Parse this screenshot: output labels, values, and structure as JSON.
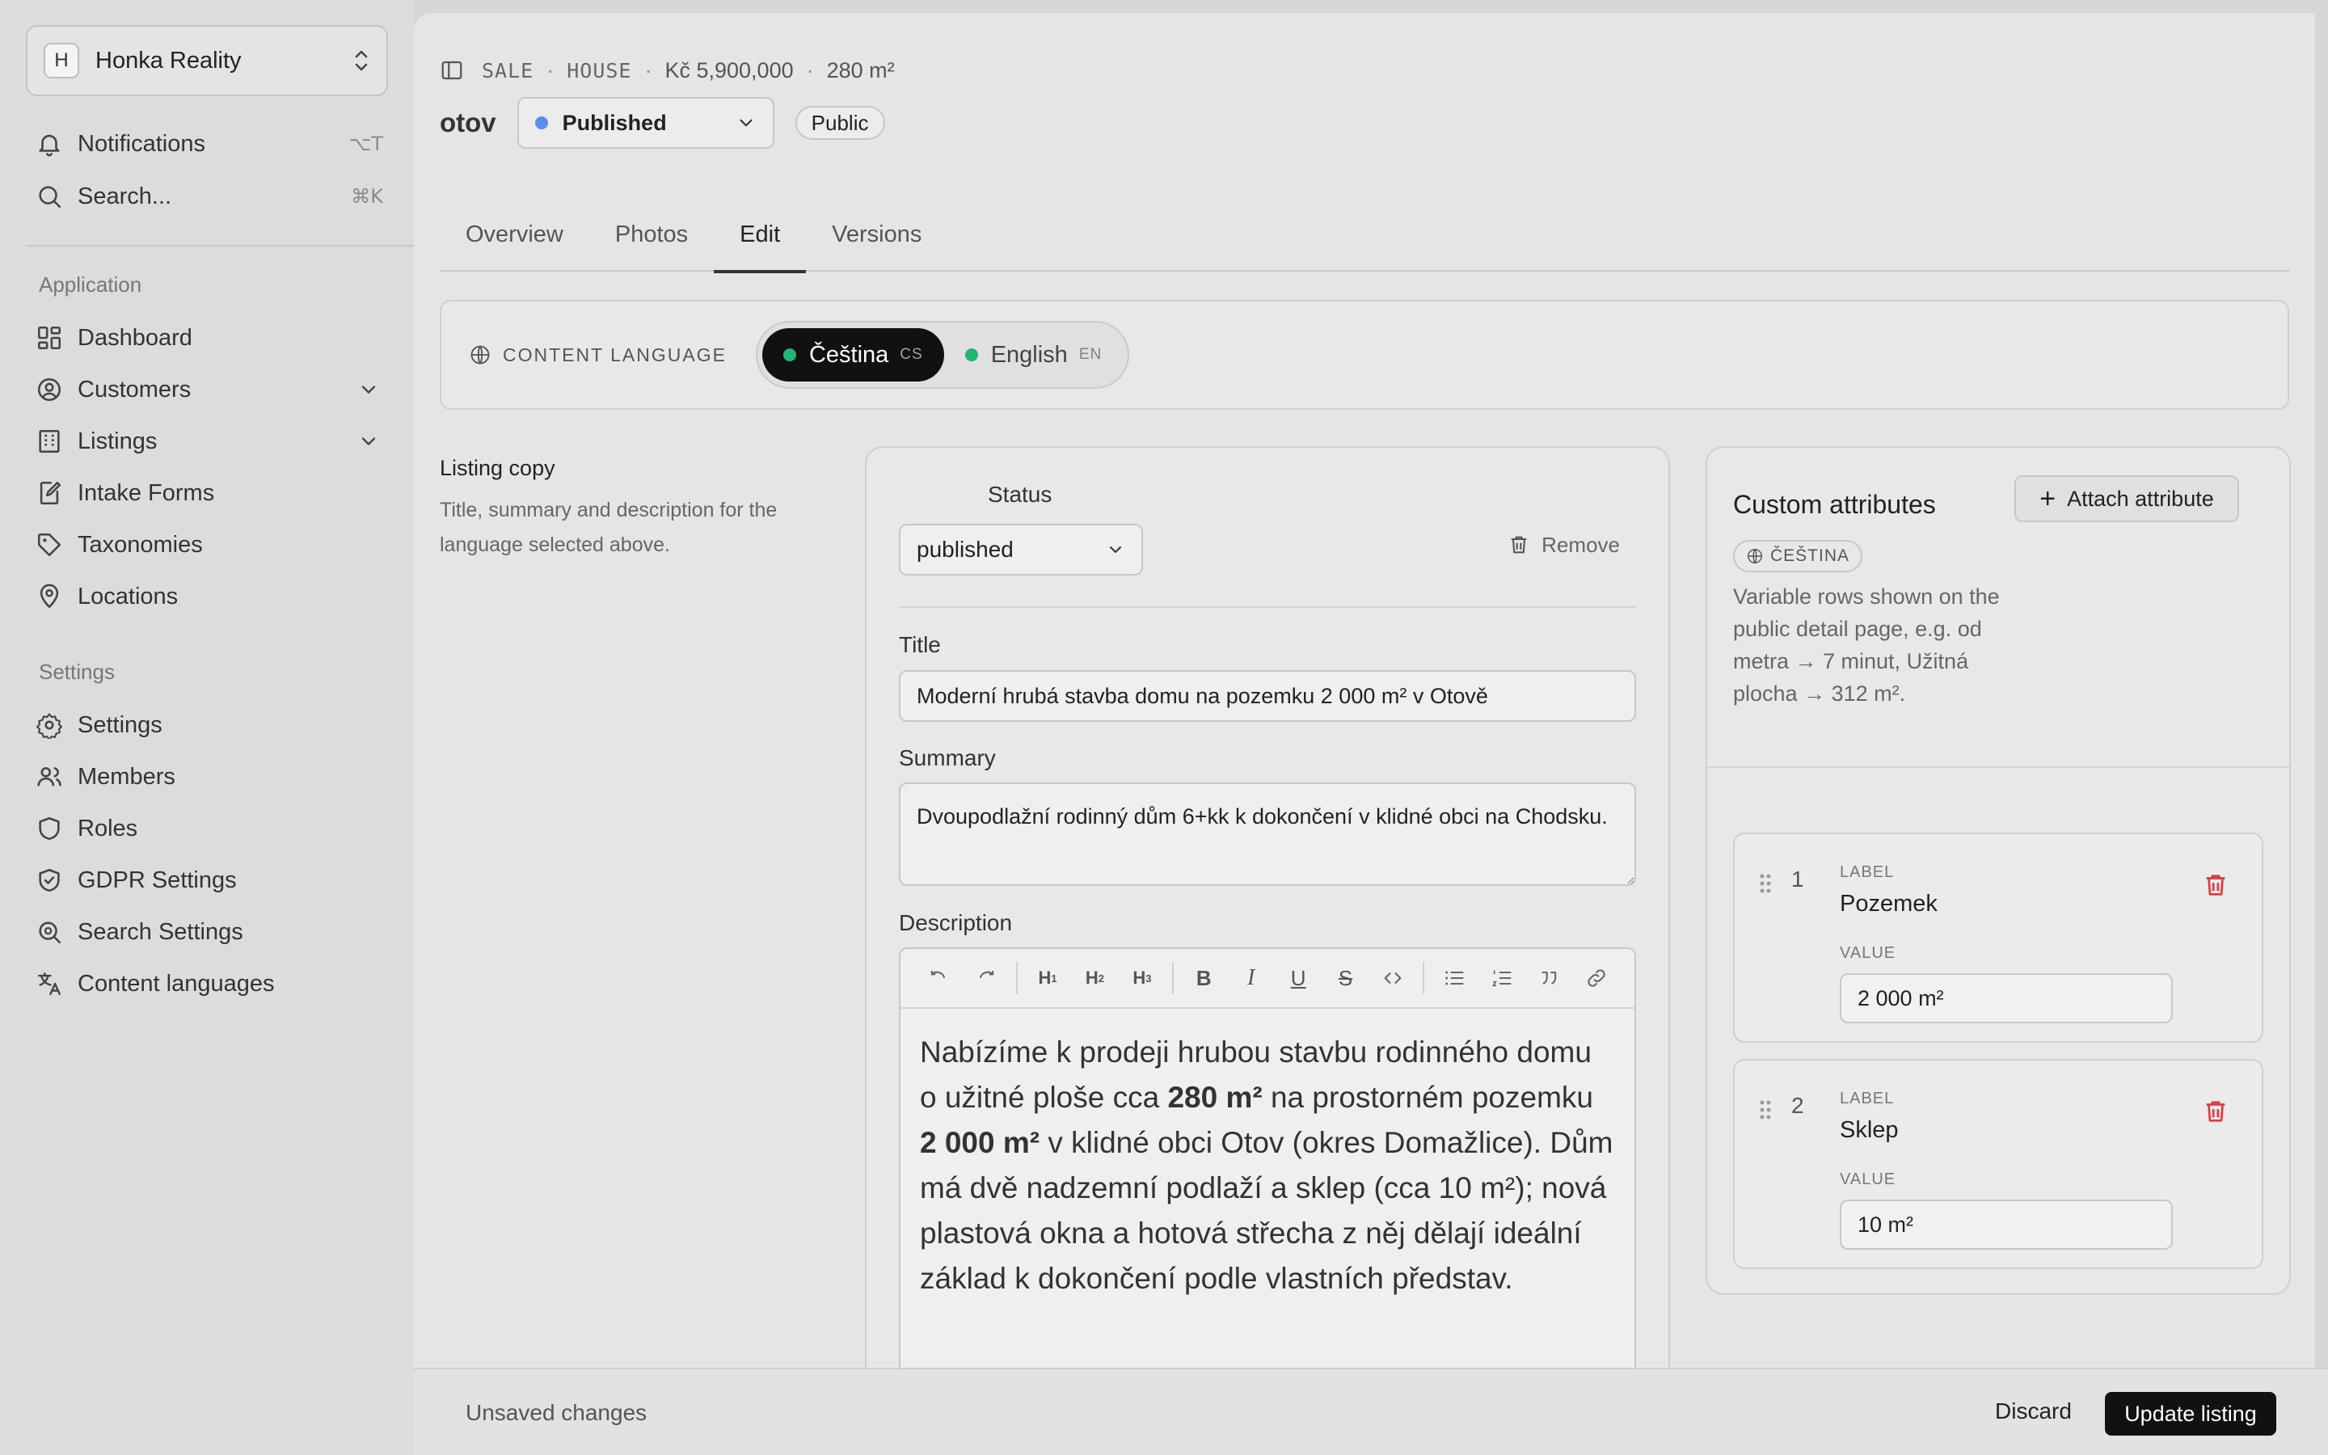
{
  "sidebar": {
    "org": {
      "initial": "H",
      "name": "Honka Reality"
    },
    "top": [
      {
        "label": "Notifications",
        "shortcut": "⌥T",
        "icon": "bell-icon"
      },
      {
        "label": "Search...",
        "shortcut": "⌘K",
        "icon": "search-icon"
      }
    ],
    "sections": [
      {
        "heading": "Application",
        "items": [
          {
            "label": "Dashboard",
            "icon": "dashboard-icon"
          },
          {
            "label": "Customers",
            "icon": "user-circle-icon",
            "expandable": true
          },
          {
            "label": "Listings",
            "icon": "building-icon",
            "expandable": true
          },
          {
            "label": "Intake Forms",
            "icon": "form-icon"
          },
          {
            "label": "Taxonomies",
            "icon": "tag-icon"
          },
          {
            "label": "Locations",
            "icon": "map-pin-icon"
          }
        ]
      },
      {
        "heading": "Settings",
        "items": [
          {
            "label": "Settings",
            "icon": "gear-icon"
          },
          {
            "label": "Members",
            "icon": "users-icon"
          },
          {
            "label": "Roles",
            "icon": "shield-icon"
          },
          {
            "label": "GDPR Settings",
            "icon": "shield-check-icon"
          },
          {
            "label": "Search Settings",
            "icon": "search-zoom-icon"
          },
          {
            "label": "Content languages",
            "icon": "translate-icon"
          }
        ]
      }
    ]
  },
  "header": {
    "breadcrumb": {
      "type": "SALE",
      "kind": "HOUSE",
      "price": "Kč 5,900,000",
      "area": "280 m²"
    },
    "title": "otov",
    "status": "Published",
    "status_color": "#5b8def",
    "visibility": "Public"
  },
  "tabs": [
    "Overview",
    "Photos",
    "Edit",
    "Versions"
  ],
  "active_tab": "Edit",
  "content_language": {
    "label": "CONTENT LANGUAGE",
    "options": [
      {
        "name": "Čeština",
        "code": "CS",
        "active": true
      },
      {
        "name": "English",
        "code": "EN",
        "active": false
      }
    ],
    "dot_color": "#22b573"
  },
  "listing_copy": {
    "heading": "Listing copy",
    "description": "Title, summary and description for the language selected above."
  },
  "form": {
    "status_label": "Status",
    "status_value": "published",
    "remove_label": "Remove",
    "title_label": "Title",
    "title_value": "Moderní hrubá stavba domu na pozemku 2 000 m² v Otově",
    "summary_label": "Summary",
    "summary_value": "Dvoupodlažní rodinný dům 6+kk k dokončení v klidné obci na Chodsku.",
    "description_label": "Description",
    "description_parts": {
      "p1": "Nabízíme k prodeji hrubou stavbu rodinného domu o užitné ploše cca ",
      "b1": "280 m²",
      "p2": " na prostorném pozemku ",
      "b2": "2 000 m²",
      "p3": " v klidné obci Otov (okres Domažlice). Dům má dvě nadzemní podlaží a sklep (cca 10 m²); nová plastová okna a hotová střecha z něj dělají ideální základ k dokončení podle vlastních představ."
    }
  },
  "custom_attributes": {
    "title": "Custom attributes",
    "attach_label": "Attach attribute",
    "language": "ČEŠTINA",
    "description": "Variable rows shown on the public detail page, e.g. od metra → 7 minut, Užitná plocha → 312 m².",
    "rows": [
      {
        "index": "1",
        "label_caption": "LABEL",
        "label": "Pozemek",
        "value_caption": "VALUE",
        "value": "2 000 m²"
      },
      {
        "index": "2",
        "label_caption": "LABEL",
        "label": "Sklep",
        "value_caption": "VALUE",
        "value": "10 m²"
      }
    ],
    "delete_color": "#e0393e"
  },
  "footer": {
    "status": "Unsaved changes",
    "discard": "Discard",
    "update": "Update listing"
  }
}
